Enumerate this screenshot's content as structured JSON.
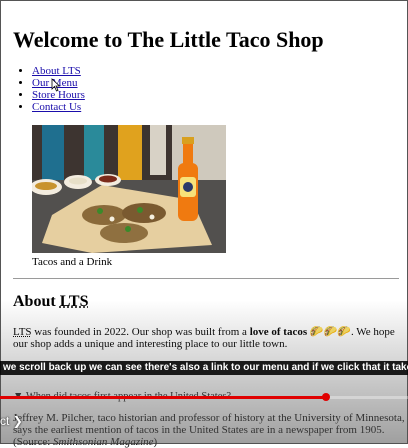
{
  "page": {
    "title": "Welcome to The Little Taco Shop",
    "nav": [
      {
        "label": "About LTS"
      },
      {
        "label": "Our Menu"
      },
      {
        "label": "Store Hours"
      },
      {
        "label": "Contact Us"
      }
    ],
    "photo_alt": "Tacos and a drink photo",
    "caption": "Tacos and a Drink",
    "about": {
      "heading_prefix": "About ",
      "heading_abbr": "LTS",
      "abbr": "LTS",
      "text_1": " was founded in 2022. Our shop was built from a ",
      "bold": "love of tacos",
      "emoji": "🌮🌮🌮",
      "text_2": ". We hope our shop adds a unique and interesting place to our little town."
    },
    "details_summary": "▼ When did tacos first appear in the United States?",
    "details_text_1": "Jeffrey M. Pilcher, taco historian and professor of history at the University of Minnesota, says the earliest mention of tacos in the United States are in a newspaper from 1905.",
    "details_source_prefix": "(Source: ",
    "details_source": "Smithsonian Magazine",
    "details_source_suffix": ")"
  },
  "video_overlay": {
    "subtitle": "we scroll back up we can see there's also a link to our menu and if we click that it takes",
    "next_label": "ct",
    "next_icon": "chevron-right-icon",
    "progress_fraction": 0.8,
    "progress_color": "#e00000"
  }
}
